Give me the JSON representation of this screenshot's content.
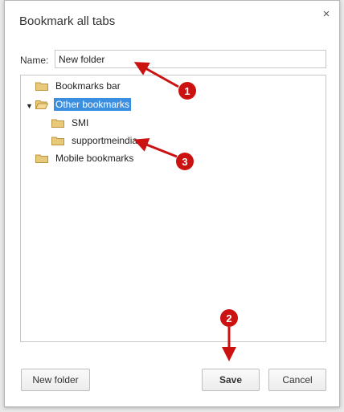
{
  "dialog": {
    "title": "Bookmark all tabs",
    "close_glyph": "×"
  },
  "name_field": {
    "label": "Name:",
    "value": "New folder"
  },
  "tree": {
    "bookmarks_bar": "Bookmarks bar",
    "other_bookmarks": "Other bookmarks",
    "smi": "SMI",
    "supportmeindia": "supportmeindia",
    "mobile_bookmarks": "Mobile bookmarks",
    "expander_glyph": "▼"
  },
  "buttons": {
    "new_folder": "New folder",
    "save": "Save",
    "cancel": "Cancel"
  },
  "annotations": {
    "badge_1": "1",
    "badge_2": "2",
    "badge_3": "3"
  },
  "colors": {
    "selection": "#3b8fe0",
    "annotation": "#cc1111",
    "folder": "#e8c879"
  }
}
